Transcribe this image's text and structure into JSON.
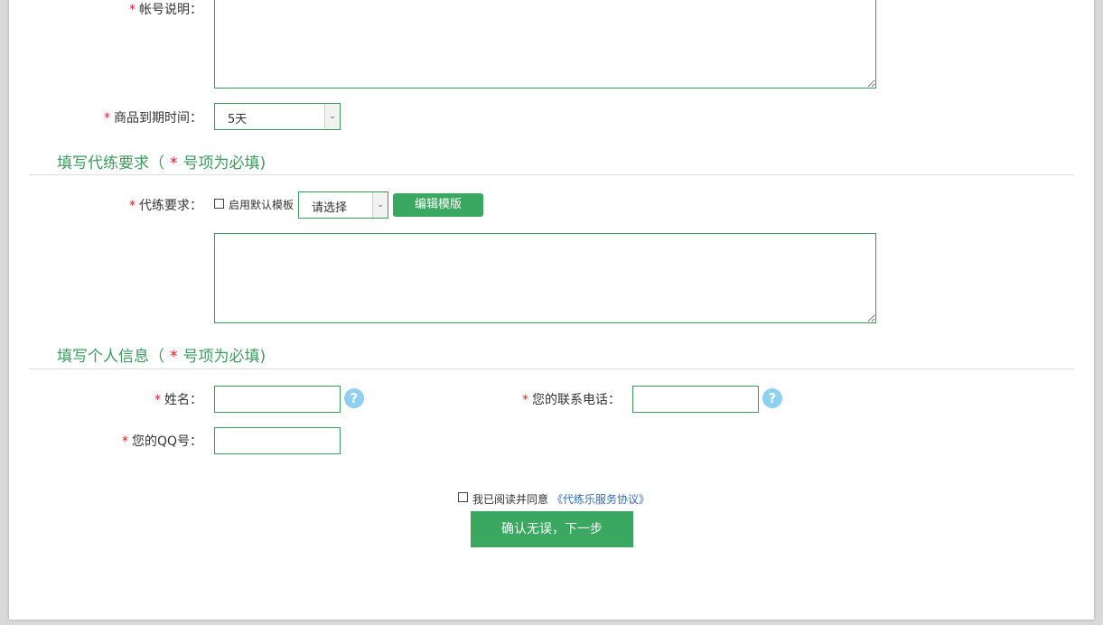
{
  "form": {
    "account_desc_label": "帐号说明：",
    "account_desc_value": "",
    "expire_label": "商品到期时间：",
    "expire_value": "5天"
  },
  "section_requirements": {
    "title": "填写代练要求（",
    "title_suffix": "号项为必填)",
    "req_label": "代练要求：",
    "use_template_label": "启用默认模板",
    "template_select_value": "请选择",
    "edit_template_button": "编辑模版",
    "requirements_value": ""
  },
  "section_personal": {
    "title": "填写个人信息（",
    "title_suffix": "号项为必填)",
    "name_label": "姓名：",
    "name_value": "",
    "phone_label": "您的联系电话：",
    "phone_value": "",
    "qq_label": "您的QQ号：",
    "qq_value": ""
  },
  "agreement": {
    "text": "我已阅读并同意",
    "link": "《代练乐服务协议》"
  },
  "submit_button": "确认无误，下一步",
  "required_mark": "*",
  "help_mark": "?",
  "colors": {
    "accent_green": "#3aa860",
    "border_green": "#3a9b5d",
    "required_red": "#e02020",
    "help_blue": "#8dd0f2",
    "link_blue": "#2f6db5"
  }
}
